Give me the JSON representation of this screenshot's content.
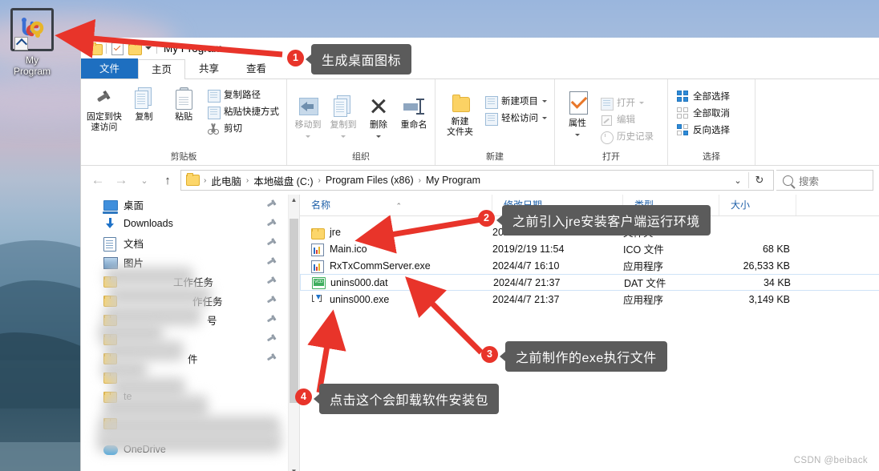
{
  "desktop": {
    "icon": {
      "label_line1": "My",
      "label_line2": "Program",
      "name": "My Program"
    }
  },
  "window": {
    "title": "My Program",
    "quick_access": [
      "folder-icon",
      "properties-icon",
      "new-folder-icon",
      "customize-caret"
    ],
    "tabs": [
      {
        "label": "文件",
        "kind": "file"
      },
      {
        "label": "主页",
        "kind": "active"
      },
      {
        "label": "共享",
        "kind": "normal"
      },
      {
        "label": "查看",
        "kind": "normal"
      }
    ]
  },
  "ribbon": {
    "groups": [
      {
        "title": "剪贴板",
        "big": [
          {
            "label_line1": "固定到快",
            "label_line2": "速访问",
            "icon": "pin-icon"
          },
          {
            "label_line1": "复制",
            "label_line2": "",
            "icon": "copy-icon"
          },
          {
            "label_line1": "粘贴",
            "label_line2": "",
            "icon": "paste-icon"
          }
        ],
        "small": [
          {
            "label": "复制路径",
            "icon": "copy-path-icon"
          },
          {
            "label": "粘贴快捷方式",
            "icon": "paste-shortcut-icon"
          },
          {
            "label": "剪切",
            "icon": "scissors-icon"
          }
        ]
      },
      {
        "title": "组织",
        "big": [
          {
            "label_line1": "移动到",
            "label_line2": "",
            "icon": "move-to-icon",
            "dim": true,
            "caret": true
          },
          {
            "label_line1": "复制到",
            "label_line2": "",
            "icon": "copy-to-icon",
            "dim": true,
            "caret": true
          },
          {
            "label_line1": "删除",
            "label_line2": "",
            "icon": "delete-icon",
            "caret": true
          },
          {
            "label_line1": "重命名",
            "label_line2": "",
            "icon": "rename-icon"
          }
        ],
        "small": []
      },
      {
        "title": "新建",
        "big": [
          {
            "label_line1": "新建",
            "label_line2": "文件夹",
            "icon": "new-folder-icon"
          }
        ],
        "small": [
          {
            "label": "新建项目",
            "icon": "new-item-icon",
            "caret": true
          },
          {
            "label": "轻松访问",
            "icon": "easy-access-icon",
            "caret": true
          }
        ]
      },
      {
        "title": "打开",
        "big": [
          {
            "label_line1": "属性",
            "label_line2": "",
            "icon": "properties-icon",
            "caret": true
          }
        ],
        "small": [
          {
            "label": "打开",
            "icon": "open-icon",
            "dim": true,
            "caret": true
          },
          {
            "label": "编辑",
            "icon": "edit-icon",
            "dim": true
          },
          {
            "label": "历史记录",
            "icon": "history-icon",
            "dim": true
          }
        ]
      },
      {
        "title": "选择",
        "big": [],
        "small": [
          {
            "label": "全部选择",
            "icon": "select-all-icon"
          },
          {
            "label": "全部取消",
            "icon": "select-none-icon"
          },
          {
            "label": "反向选择",
            "icon": "invert-selection-icon"
          }
        ]
      }
    ]
  },
  "addressbar": {
    "back": "←",
    "forward": "→",
    "recent": "⌄",
    "up": "↑",
    "breadcrumbs": [
      "此电脑",
      "本地磁盘 (C:)",
      "Program Files (x86)",
      "My Program"
    ],
    "separator": "›",
    "dropdown": "⌄",
    "refresh": "↻",
    "search_placeholder": "搜索"
  },
  "navpane": {
    "items": [
      {
        "label": "桌面",
        "icon": "desktop-icon",
        "pinned": true,
        "blurred": false
      },
      {
        "label": "Downloads",
        "icon": "download-icon",
        "pinned": true,
        "blurred": false
      },
      {
        "label": "文档",
        "icon": "documents-icon",
        "pinned": true,
        "blurred": false
      },
      {
        "label": "图片",
        "icon": "pictures-icon",
        "pinned": true,
        "blurred": false
      },
      {
        "label": "工作任务",
        "icon": "folder-icon",
        "pinned": true,
        "blurred": true
      },
      {
        "label": "作任务",
        "icon": "folder-icon",
        "pinned": true,
        "blurred": true
      },
      {
        "label": "号",
        "icon": "folder-icon",
        "pinned": true,
        "blurred": true
      },
      {
        "label": "",
        "icon": "folder-icon",
        "pinned": true,
        "blurred": true
      },
      {
        "label": "件",
        "icon": "folder-icon",
        "pinned": true,
        "blurred": true
      },
      {
        "label": "",
        "icon": "folder-icon",
        "pinned": false,
        "blurred": true
      },
      {
        "label": "te",
        "icon": "folder-icon",
        "pinned": false,
        "blurred": true
      },
      {
        "label": "",
        "icon": "folder-icon",
        "pinned": false,
        "blurred": true
      },
      {
        "label": "OneDrive",
        "icon": "onedrive-icon",
        "pinned": false,
        "blurred": false
      }
    ]
  },
  "filelist": {
    "columns": [
      {
        "label": "名称",
        "sorted": "asc"
      },
      {
        "label": "修改日期",
        "sorted": ""
      },
      {
        "label": "类型",
        "sorted": ""
      },
      {
        "label": "大小",
        "sorted": ""
      }
    ],
    "rows": [
      {
        "name": "jre",
        "date": "2024/4/7 21:37",
        "type": "文件夹",
        "size": "",
        "icon": "folder-icon",
        "selected": false
      },
      {
        "name": "Main.ico",
        "date": "2019/2/19 11:54",
        "type": "ICO 文件",
        "size": "68 KB",
        "icon": "ico-file-icon",
        "selected": false
      },
      {
        "name": "RxTxCommServer.exe",
        "date": "2024/4/7 16:10",
        "type": "应用程序",
        "size": "26,533 KB",
        "icon": "ico-file-icon",
        "selected": false
      },
      {
        "name": "unins000.dat",
        "date": "2024/4/7 21:37",
        "type": "DAT 文件",
        "size": "34 KB",
        "icon": "dat-file-icon",
        "selected": true
      },
      {
        "name": "unins000.exe",
        "date": "2024/4/7 21:37",
        "type": "应用程序",
        "size": "3,149 KB",
        "icon": "exe-file-icon",
        "selected": false
      }
    ]
  },
  "annotations": {
    "accent_color": "#e8342a",
    "box_color": "#5b5b5b",
    "items": [
      {
        "number": "1",
        "text": "生成桌面图标"
      },
      {
        "number": "2",
        "text": "之前引入jre安装客户端运行环境"
      },
      {
        "number": "3",
        "text": "之前制作的exe执行文件"
      },
      {
        "number": "4",
        "text": "点击这个会卸载软件安装包"
      }
    ]
  },
  "watermark": "CSDN @beiback"
}
